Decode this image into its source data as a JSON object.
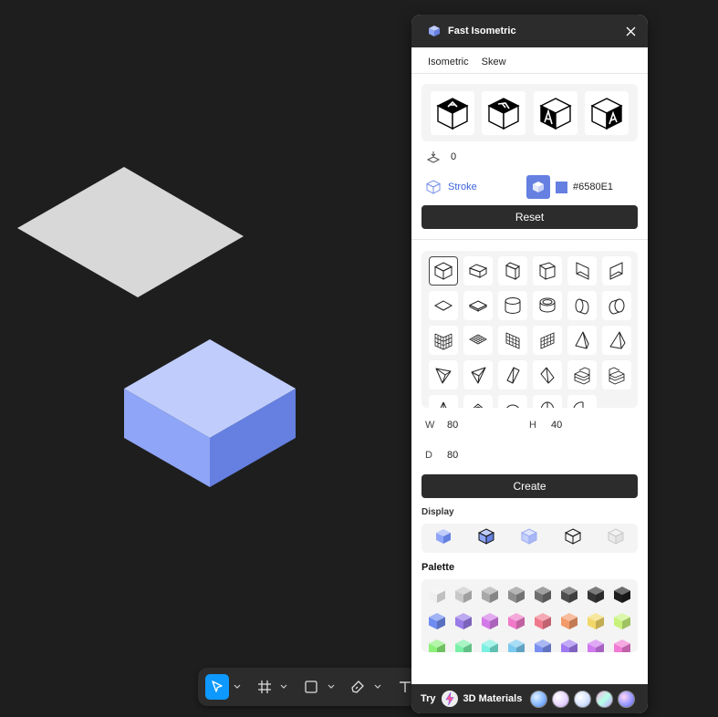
{
  "panel": {
    "title": "Fast Isometric",
    "tabs": [
      "Isometric",
      "Skew"
    ],
    "offset_value": "0",
    "stroke_label": "Stroke",
    "stroke_color": "#6580E1",
    "reset_label": "Reset",
    "create_label": "Create",
    "display_label": "Display",
    "palette_label": "Palette",
    "dims": {
      "w_label": "W",
      "w_value": "80",
      "h_label": "H",
      "h_value": "40",
      "d_label": "D",
      "d_value": "80"
    },
    "footer": {
      "try_label": "Try",
      "materials_label": "3D Materials"
    }
  },
  "colors": {
    "accent": "#6580E1",
    "panel_dark": "#2c2c2c",
    "canvas": "#1e1e1e",
    "tool_active": "#0d99ff"
  },
  "palette_rows": [
    [
      "#f0f0f0",
      "#c8c8c8",
      "#a8a8a8",
      "#8e8e8e",
      "#6e6e6e",
      "#4e4e4e",
      "#353535",
      "#1e1e1e"
    ],
    [
      "#6f8cf0",
      "#9a7be8",
      "#d47ae8",
      "#f07ac8",
      "#f07a8c",
      "#f49a6a",
      "#f2d86a",
      "#c8f27a"
    ],
    [
      "#8cf07a",
      "#7af0a8",
      "#7af0e0",
      "#7acaf0",
      "#7a90f0",
      "#a07af0",
      "#d07af0",
      "#f07ad4"
    ]
  ]
}
